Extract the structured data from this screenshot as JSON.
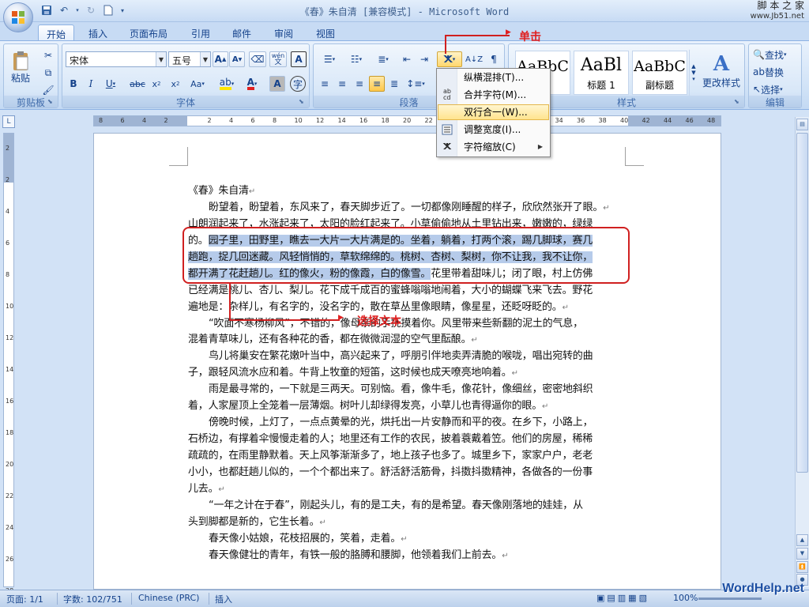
{
  "window": {
    "title": "《春》朱自清 [兼容模式] - Microsoft Word",
    "watermark_top": "脚 本 之 家",
    "watermark_site": "www.Jb51.net",
    "watermark_bottom": "WordHelp.net"
  },
  "tabs": [
    "开始",
    "插入",
    "页面布局",
    "引用",
    "邮件",
    "审阅",
    "视图"
  ],
  "ribbon": {
    "clipboard": {
      "label": "剪贴板",
      "paste": "粘贴"
    },
    "font": {
      "label": "字体",
      "font_name": "宋体",
      "font_size": "五号",
      "wen": "wén",
      "A_box": "A"
    },
    "paragraph": {
      "label": "段落"
    },
    "styles": {
      "label": "样式",
      "items": [
        {
          "sample": "AaBbC",
          "name": ""
        },
        {
          "sample": "AaBl",
          "name": "标题 1"
        },
        {
          "sample": "AaBbC",
          "name": "副标题"
        }
      ],
      "change_styles": "更改样式"
    },
    "editing": {
      "label": "编辑",
      "find": "查找",
      "replace": "替换",
      "select": "选择"
    }
  },
  "menu": {
    "items": [
      {
        "label": "纵横混排(T)...",
        "icon": "vertical-mix-icon"
      },
      {
        "label": "合并字符(M)...",
        "icon": "combine-chars-icon"
      },
      {
        "label": "双行合一(W)...",
        "icon": "two-lines-in-one-icon",
        "highlighted": true
      },
      {
        "label": "调整宽度(I)...",
        "icon": "fit-width-icon"
      },
      {
        "label": "字符缩放(C)",
        "icon": "char-scale-icon",
        "submenu": true
      }
    ]
  },
  "annotations": {
    "click": "单击",
    "select_text": "选择文本"
  },
  "ruler": {
    "h_marks": [
      "8",
      "6",
      "4",
      "2",
      "",
      "2",
      "4",
      "6",
      "8",
      "10",
      "12",
      "14",
      "16",
      "18",
      "20",
      "22",
      "24",
      "26",
      "28",
      "30",
      "32",
      "34",
      "36",
      "38",
      "40",
      "42",
      "44",
      "46",
      "48"
    ],
    "v_marks": [
      "2",
      "",
      "2",
      "",
      "4",
      "",
      "6",
      "",
      "8",
      "",
      "10",
      "",
      "12",
      "",
      "14",
      "",
      "16",
      "",
      "18",
      "",
      "20",
      "",
      "22",
      "",
      "24",
      "",
      "26",
      "",
      "28"
    ]
  },
  "document": {
    "lines": [
      {
        "text": "《春》朱自清",
        "indent": false
      },
      {
        "text": "盼望着，盼望着，东风来了，春天脚步近了。一切都像刚睡醒的样子，欣欣然张开了眼。",
        "indent": true
      },
      {
        "text": "山朗润起来了，水涨起来了，太阳的脸红起来了。小草偷偷地从土里钻出来，嫩嫩的，绿绿",
        "indent": false
      },
      {
        "pre": "的。",
        "sel": "园子里，田野里，瞧去一大片一大片满是的。坐着，躺着，打两个滚，踢几脚球，赛几",
        "indent": false
      },
      {
        "sel": "趟跑，捉几回迷藏。风轻悄悄的，草软绵绵的。桃树、杏树、梨树，你不让我，我不让你，",
        "indent": false
      },
      {
        "sel": "都开满了花赶趟儿。红的像火，粉的像霞，白的像雪。",
        "post": "花里带着甜味儿；闭了眼，村上仿佛",
        "indent": false
      },
      {
        "text": "已经满是桃儿、杏儿、梨儿。花下成千成百的蜜蜂嗡嗡地闹着，大小的蝴蝶飞来飞去。野花",
        "indent": false
      },
      {
        "text": "遍地是：杂样儿，有名字的，没名字的，散在草丛里像眼睛，像星星，还眨呀眨的。",
        "indent": false
      },
      {
        "text": "“吹面不寒杨柳风”，不错的，像母亲的手抚摸着你。风里带来些新翻的泥土的气息，",
        "indent": true
      },
      {
        "text": "混着青草味儿，还有各种花的香，都在微微润湿的空气里酝酿。",
        "indent": false
      },
      {
        "text": "鸟儿将巢安在繁花嫩叶当中，高兴起来了，呼朋引伴地卖弄清脆的喉咙，唱出宛转的曲",
        "indent": true
      },
      {
        "text": "子，跟轻风流水应和着。牛背上牧童的短笛，这时候也成天嘹亮地响着。",
        "indent": false
      },
      {
        "text": "雨是最寻常的，一下就是三两天。可别恼。看，像牛毛，像花针，像细丝，密密地斜织",
        "indent": true
      },
      {
        "text": "着，人家屋顶上全笼着一层薄烟。树叶儿却绿得发亮，小草儿也青得逼你的眼。",
        "indent": false
      },
      {
        "text": "傍晚时候，上灯了，一点点黄晕的光，烘托出一片安静而和平的夜。在乡下，小路上，",
        "indent": true
      },
      {
        "text": "石桥边，有撑着伞慢慢走着的人；地里还有工作的农民，披着蓑戴着笠。他们的房屋，稀稀",
        "indent": false
      },
      {
        "text": "疏疏的，在雨里静默着。天上风筝渐渐多了，地上孩子也多了。城里乡下，家家户户，老老",
        "indent": false
      },
      {
        "text": "小小，也都赶趟儿似的，一个个都出来了。舒活舒活筋骨，抖擞抖擞精神，各做各的一份事",
        "indent": false
      },
      {
        "text": "儿去。",
        "indent": false
      },
      {
        "text": "“一年之计在于春”，刚起头儿，有的是工夫，有的是希望。春天像刚落地的娃娃，从",
        "indent": true
      },
      {
        "text": "头到脚都是新的，它生长着。",
        "indent": false
      },
      {
        "text": "春天像小姑娘，花枝招展的，笑着，走着。",
        "indent": true
      },
      {
        "text": "春天像健壮的青年，有铁一般的胳膊和腰脚，他领着我们上前去。",
        "indent": true
      }
    ]
  },
  "status": {
    "page": "页面: 1/1",
    "words": "字数: 102/751",
    "lang": "Chinese (PRC)",
    "mode": "插入",
    "zoom": "100%"
  },
  "colors": {
    "accent": "#15428b",
    "annotation": "#d02020",
    "selection": "#b6cbea",
    "menu_highlight": "#ffe48e"
  }
}
